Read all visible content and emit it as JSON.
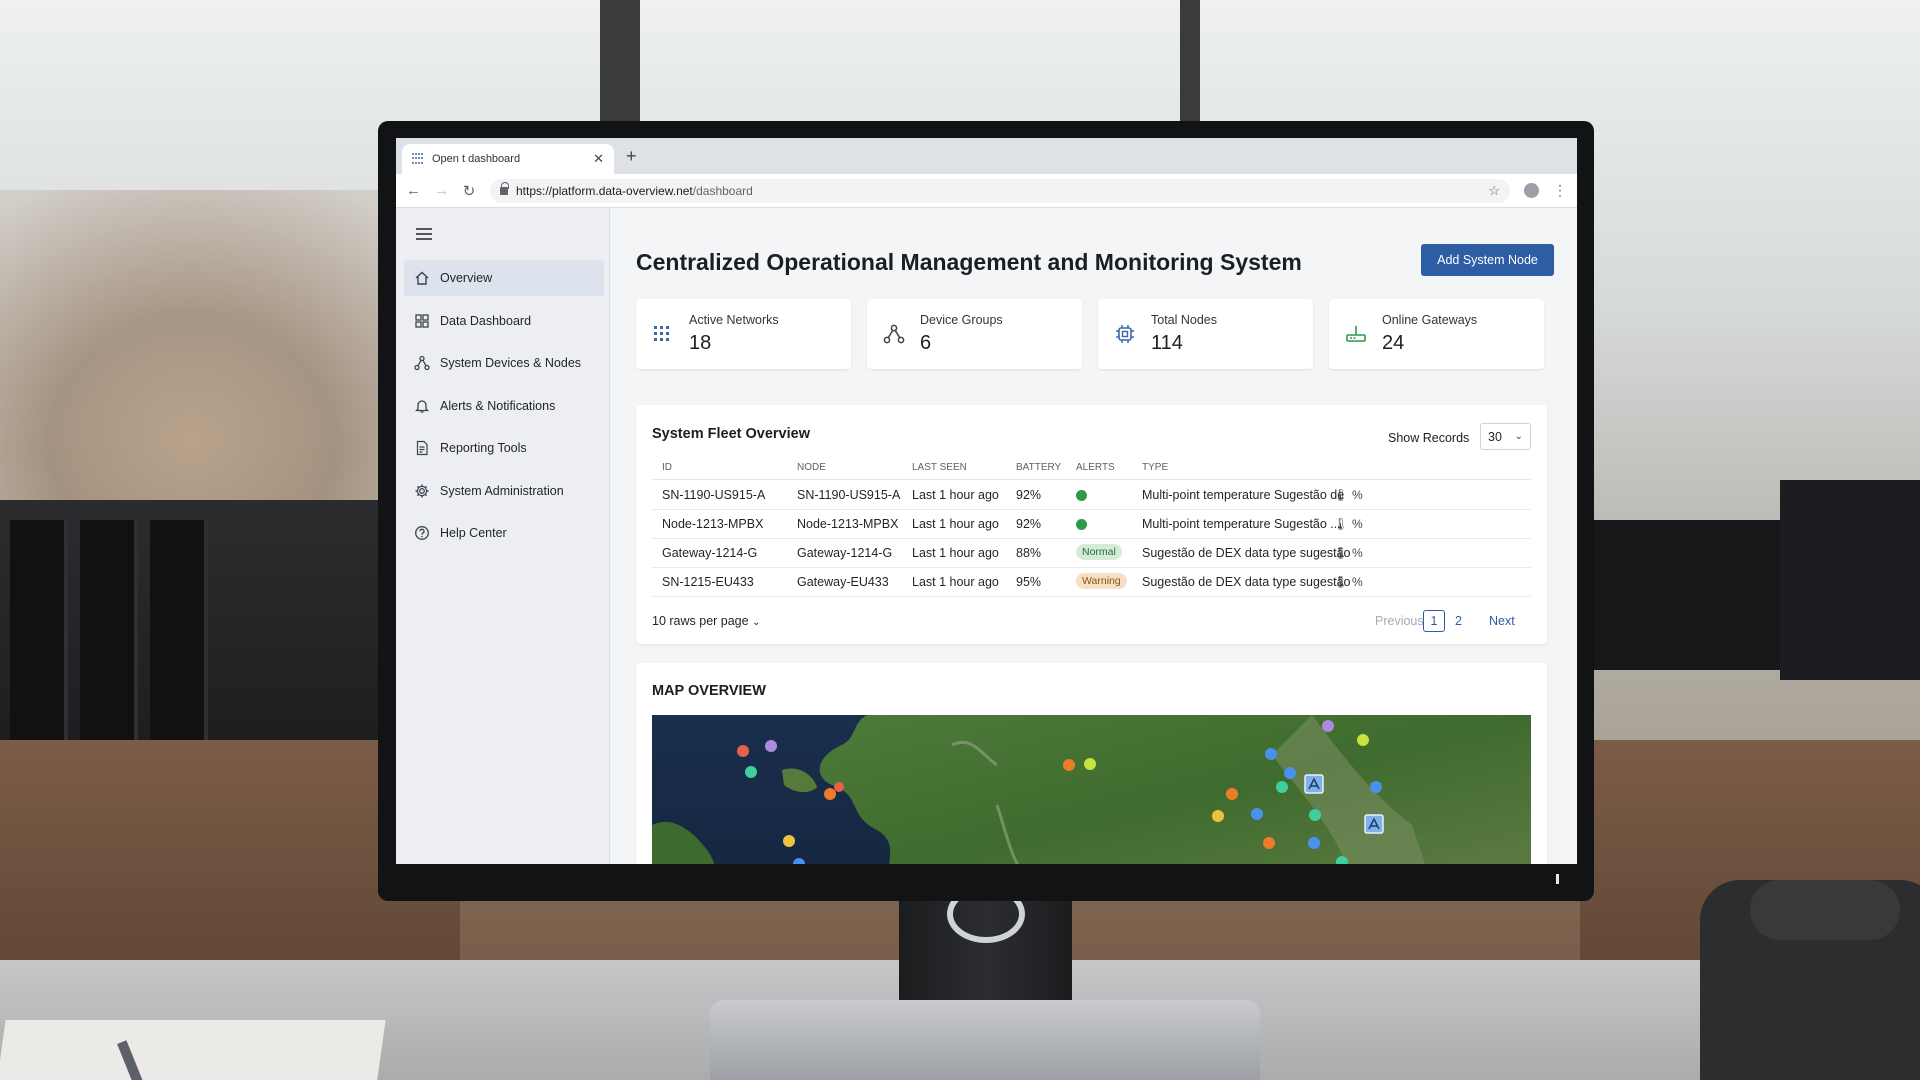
{
  "browser": {
    "tab_title": "Open t dashboard",
    "url_host": "https://platform.data-overview.net",
    "url_path": "/dashboard"
  },
  "sidebar": {
    "items": [
      {
        "label": "Overview",
        "icon": "home-icon",
        "active": true
      },
      {
        "label": "Data Dashboard",
        "icon": "grid-icon",
        "active": false
      },
      {
        "label": "System Devices & Nodes",
        "icon": "nodes-icon",
        "active": false
      },
      {
        "label": "Alerts & Notifications",
        "icon": "bell-icon",
        "active": false
      },
      {
        "label": "Reporting Tools",
        "icon": "document-icon",
        "active": false
      },
      {
        "label": "System Administration",
        "icon": "gear-icon",
        "active": false
      },
      {
        "label": "Help Center",
        "icon": "help-icon",
        "active": false
      }
    ]
  },
  "header": {
    "title": "Centralized Operational Management and Monitoring System",
    "add_button": "Add System Node"
  },
  "stats": [
    {
      "label": "Active Networks",
      "value": "18",
      "icon": "network-grid-icon"
    },
    {
      "label": "Device Groups",
      "value": "6",
      "icon": "device-groups-icon"
    },
    {
      "label": "Total Nodes",
      "value": "114",
      "icon": "nodes-chip-icon"
    },
    {
      "label": "Online Gateways",
      "value": "24",
      "icon": "gateway-router-icon"
    }
  ],
  "fleet": {
    "title": "System Fleet Overview",
    "show_records_label": "Show Records",
    "show_records_value": "30",
    "columns": [
      "ID",
      "NODE",
      "LAST SEEN",
      "BATTERY",
      "ALERTS",
      "TYPE"
    ],
    "rows": [
      {
        "id": "SN-1190-US915-A",
        "node": "SN-1190-US915-A",
        "last_seen": "Last 1 hour ago",
        "battery": "92%",
        "alert": "dot",
        "type": "Multi-point temperature Sugestão de"
      },
      {
        "id": "Node-1213-MPBX",
        "node": "Node-1213-MPBX",
        "last_seen": "Last 1 hour ago",
        "battery": "92%",
        "alert": "dot",
        "type": "Multi-point temperature Sugestão ..."
      },
      {
        "id": "Gateway-1214-G",
        "node": "Gateway-1214-G",
        "last_seen": "Last 1 hour ago",
        "battery": "88%",
        "alert": "Normal",
        "type": "Sugestão de DEX data type sugestão"
      },
      {
        "id": "SN-1215-EU433",
        "node": "Gateway-EU433",
        "last_seen": "Last 1 hour ago",
        "battery": "95%",
        "alert": "Warning",
        "type": "Sugestão de DEX data type sugestão"
      }
    ],
    "per_page": "10 raws per page",
    "pagination": {
      "previous": "Previous",
      "pages": [
        "1",
        "2"
      ],
      "current": "1",
      "next": "Next"
    }
  },
  "map": {
    "title": "MAP OVERVIEW",
    "marker_colors": {
      "red": "#e8604a",
      "purple": "#a98be0",
      "teal": "#3ecf9c",
      "orange": "#ee7b2a",
      "yellow": "#eec23f",
      "lime": "#c6e33f",
      "blue": "#4a90f0"
    }
  },
  "colors": {
    "accent": "#2f5da3",
    "status_ok": "#2e9a45"
  }
}
